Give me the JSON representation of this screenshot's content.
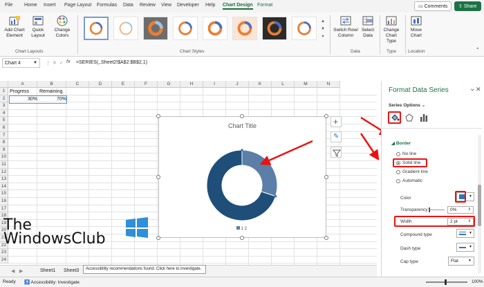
{
  "menu": {
    "tabs": [
      "File",
      "Home",
      "Insert",
      "Page Layout",
      "Formulas",
      "Data",
      "Review",
      "View",
      "Developer",
      "Help",
      "Chart Design",
      "Format"
    ],
    "comments": "Comments",
    "share": "Share"
  },
  "ribbon": {
    "add_chart_element": "Add Chart Element",
    "quick_layout": "Quick Layout",
    "change_colors": "Change Colors",
    "chart_layouts": "Chart Layouts",
    "chart_styles": "Chart Styles",
    "switch_row_column": "Switch Row/ Column",
    "select_data": "Select Data",
    "data_group": "Data",
    "change_chart_type": "Change Chart Type",
    "type_group": "Type",
    "move_chart": "Move Chart",
    "location_group": "Location"
  },
  "formula_bar": {
    "name_box": "Chart 4",
    "fx": "fx",
    "formula": "=SERIES(,,Sheet2!$A$2:$B$2,1)"
  },
  "columns": [
    "A",
    "B",
    "C",
    "D",
    "E",
    "F",
    "G",
    "H",
    "I",
    "J",
    "K",
    "L",
    "M",
    "N"
  ],
  "rows": [
    "1",
    "2",
    "3",
    "4",
    "5",
    "6",
    "7",
    "8",
    "9",
    "10",
    "11",
    "12",
    "13",
    "14",
    "15",
    "16",
    "17",
    "18",
    "19",
    "20",
    "21",
    "22",
    "23",
    "24"
  ],
  "cells": {
    "a1": "Progress",
    "b1": "Remaining",
    "a2": "30%",
    "b2": "70%"
  },
  "chart": {
    "title": "Chart Title",
    "legend": "1  2"
  },
  "chart_data": {
    "type": "pie",
    "title": "Chart Title",
    "categories": [
      "1",
      "2"
    ],
    "values": [
      30,
      70
    ],
    "colors": [
      "#5b7fa6",
      "#1f4e79"
    ]
  },
  "sheets": {
    "sheet1": "Sheet1",
    "sheet3": "Sheet3",
    "tooltip": "Accessibility recommendations found. Click here to investigate."
  },
  "status": {
    "ready": "Ready",
    "accessibility": "Accessibility: Investigate",
    "zoom": "100%"
  },
  "pane": {
    "title": "Format Data Series",
    "series_options": "Series Options",
    "border": "Border",
    "no_line": "No line",
    "solid_line": "Solid line",
    "gradient_line": "Gradient line",
    "automatic": "Automatic",
    "color": "Color",
    "transparency": "Transparency",
    "transparency_value": "0%",
    "width": "Width",
    "width_value": "2 pt",
    "compound_type": "Compound type",
    "dash_type": "Dash type",
    "cap_type": "Cap type",
    "cap_value": "Flat"
  },
  "watermark": {
    "line1": "The",
    "line2": "WindowsClub"
  },
  "colors": {
    "accent": "#1e7145",
    "donut_dark": "#1f4e79",
    "donut_light": "#5b7fa6",
    "annotation_red": "#e11111"
  }
}
